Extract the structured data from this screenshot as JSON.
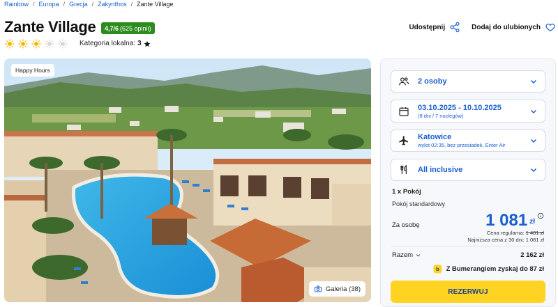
{
  "breadcrumb": [
    "Rainbow",
    "Europa",
    "Grecja",
    "Zakynthos",
    "Zante Village"
  ],
  "breadcrumb_sep": "/",
  "hotel": {
    "name": "Zante Village",
    "rating": "4,7/6",
    "rating_count": "(625 opinii)",
    "suns_filled": 3,
    "suns_total": 5,
    "local_category_label": "Kategoria lokalna:",
    "local_category_value": "3"
  },
  "actions": {
    "share": "Udostępnij",
    "favorite": "Dodaj do ulubionych"
  },
  "photo": {
    "badge": "Happy Hours",
    "gallery": "Galeria (38)"
  },
  "booking": {
    "persons": "2 osoby",
    "dates": "03.10.2025 - 10.10.2025",
    "dates_sub": "(8 dni / 7 noclegów)",
    "departure": "Katowice",
    "departure_sub": "wylot 02:35, bez przesiadek, Enter Air",
    "board": "All inclusive",
    "room_count": "1 x Pokój",
    "room_type": "Pokój standardowy",
    "per_person_label": "Za osobę",
    "price": "1 081",
    "currency": "zł",
    "regular_label": "Cena regularna:",
    "regular_price": "1 481 zł",
    "lowest_label": "Najniższa cena z 30 dni:",
    "lowest_price": "1 081 zł",
    "total_label": "Razem",
    "total": "2 162 zł",
    "bumerang": "Z Bumerangiem zyskaj do 87 zł",
    "reserve": "REZERWUJ"
  },
  "colors": {
    "accent": "#1a5ecf",
    "rating_green": "#2e8b1f",
    "reserve_yellow": "#ffd321",
    "sun": "#f5b400"
  }
}
